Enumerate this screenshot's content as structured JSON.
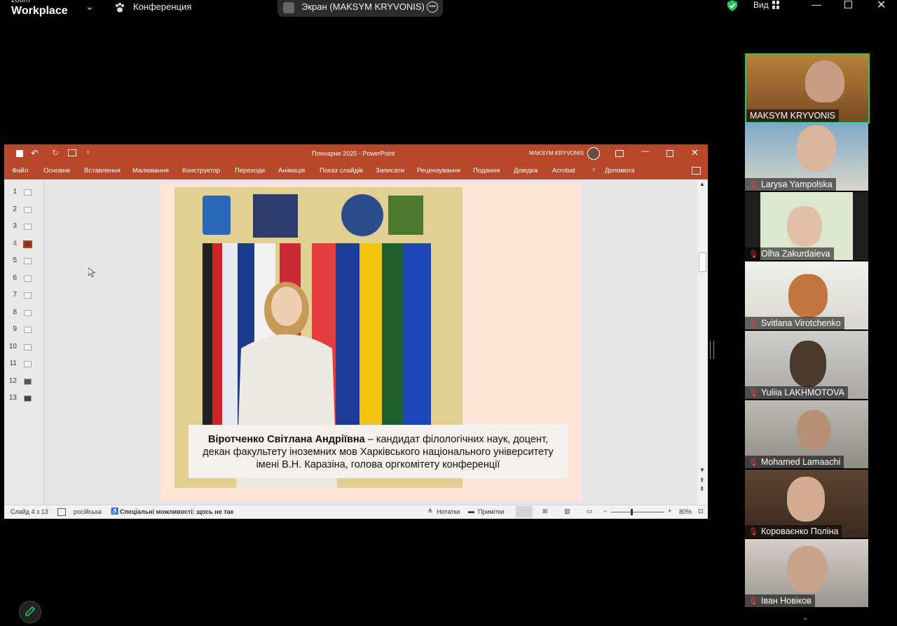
{
  "zoom": {
    "brand_line1": "zoom",
    "brand_line2": "Workplace",
    "meeting_label": "Конференция",
    "share_label": "Экран (MAKSYM KRYVONIS)",
    "view_label": "Вид",
    "security_color": "#22c55e"
  },
  "ppt": {
    "title": "Пленарне 2025  -  PowerPoint",
    "user": "MAKSYM KRYVONIS",
    "accent": "#b7472a",
    "ribbon": [
      "Файл",
      "Основне",
      "Вставлення",
      "Малювання",
      "Конструктор",
      "Переходи",
      "Анімація",
      "Показ слайдів",
      "Записати",
      "Рецензування",
      "Подання",
      "Довідка",
      "Acrobat"
    ],
    "tell_me": "Допомога",
    "thumbnails": [
      "1",
      "2",
      "3",
      "4",
      "5",
      "6",
      "7",
      "8",
      "9",
      "10",
      "11",
      "12",
      "13"
    ],
    "selected_slide": "4",
    "caption_bold": "Віротченко Світлана Андріївна",
    "caption_line1_rest": "  – кандидат  філологічних наук, доцент,",
    "caption_line2": "декан факультету іноземних мов Харківського національного університету",
    "caption_line3": "імені В.Н. Каразіна, голова оргкомітету конференції",
    "status": {
      "slide": "Слайд 4 з 13",
      "language": "російська",
      "accessibility": "Спеціальні можливості: щось не так",
      "notes": "Нотатки",
      "comments": "Примітки",
      "zoom": "80%"
    }
  },
  "participants": [
    {
      "name": "MAKSYM KRYVONIS",
      "muted": false,
      "active": true
    },
    {
      "name": "Larysa Yampolska",
      "muted": true,
      "active": false
    },
    {
      "name": "Olha Zakurdaieva",
      "muted": true,
      "active": false
    },
    {
      "name": "Svitlana Virotchenko",
      "muted": true,
      "active": false
    },
    {
      "name": "Yuliia LAKHMOTOVA",
      "muted": true,
      "active": false
    },
    {
      "name": "Mohamed Lamaachi",
      "muted": true,
      "active": false
    },
    {
      "name": "Короваєнко Поліна",
      "muted": true,
      "active": false
    },
    {
      "name": "Іван Новіков",
      "muted": true,
      "active": false
    }
  ]
}
